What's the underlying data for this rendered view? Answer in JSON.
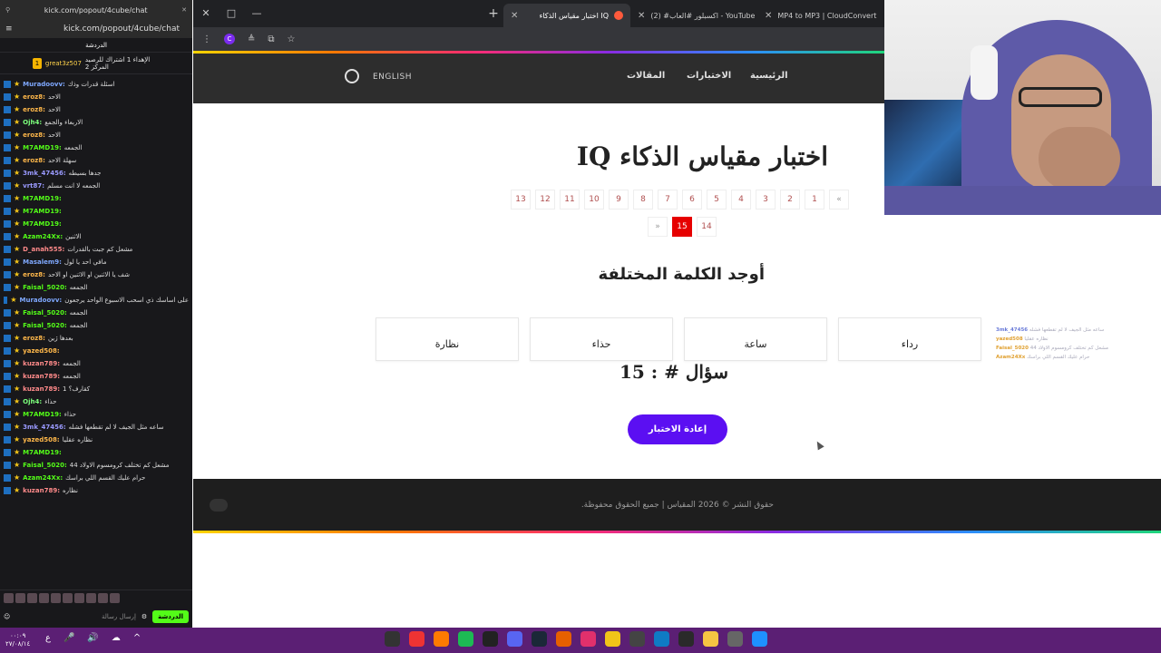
{
  "chat_window": {
    "url": "kick.com/popout/4cube/chat",
    "tab_title": "kick.com/popout/4cube/chat",
    "header": "الدردشة",
    "pinned_user": "great3z507",
    "pinned_text": "الإهداء 1 اشتراك للرصيد المركز 2",
    "send_button": "الدردشة",
    "input_placeholder": "إرسال رسالة",
    "messages": [
      {
        "user": "Muradoovv:",
        "text": "اسئلة قدرات وذك",
        "color": "#7fa8ff"
      },
      {
        "user": "eroz8:",
        "text": "الاحد",
        "color": "#ffb84a"
      },
      {
        "user": "eroz8:",
        "text": "الاحد",
        "color": "#ffb84a"
      },
      {
        "user": "Ojh4:",
        "text": "الاربعاء والجمع",
        "color": "#7cff7c"
      },
      {
        "user": "eroz8:",
        "text": "الاحد",
        "color": "#ffb84a"
      },
      {
        "user": "M7AMD19:",
        "text": "الجمعه",
        "color": "#53fc18"
      },
      {
        "user": "eroz8:",
        "text": "سهلة الاحد",
        "color": "#ffb84a"
      },
      {
        "user": "3mk_47456:",
        "text": "جدها بسيطه",
        "color": "#9a9aff"
      },
      {
        "user": "vrt87:",
        "text": "الجمعه لا انت مسلم",
        "color": "#9a9aff"
      },
      {
        "user": "M7AMD19:",
        "text": "",
        "color": "#53fc18"
      },
      {
        "user": "M7AMD19:",
        "text": "",
        "color": "#53fc18"
      },
      {
        "user": "M7AMD19:",
        "text": "",
        "color": "#53fc18"
      },
      {
        "user": "Azam24Xx:",
        "text": "الاثنين",
        "color": "#53fc18"
      },
      {
        "user": "D_anah555:",
        "text": "مشعل كم جبت بالقدرات",
        "color": "#ff8a8a"
      },
      {
        "user": "Masalem9:",
        "text": "مافي احد يا لول",
        "color": "#7fa8ff"
      },
      {
        "user": "eroz8:",
        "text": "شف يا الاثنين او الاثنين او الاحد",
        "color": "#ffb84a"
      },
      {
        "user": "Faisal_5020:",
        "text": "الجمعه",
        "color": "#53fc18"
      },
      {
        "user": "Muradoovv:",
        "text": "على اساسك ذي اسحب الاسبوع الواحد يرجعون",
        "color": "#7fa8ff"
      },
      {
        "user": "Faisal_5020:",
        "text": "الجمعه",
        "color": "#53fc18"
      },
      {
        "user": "Faisal_5020:",
        "text": "الجمعه",
        "color": "#53fc18"
      },
      {
        "user": "eroz8:",
        "text": "بعدها ژين",
        "color": "#ffb84a"
      },
      {
        "user": "yazed508:",
        "text": "",
        "color": "#ffb84a"
      },
      {
        "user": "kuzan789:",
        "text": "الجمعه",
        "color": "#ff8a8a"
      },
      {
        "user": "kuzan789:",
        "text": "الجمعه",
        "color": "#ff8a8a"
      },
      {
        "user": "kuzan789:",
        "text": "1 كقارف؟",
        "color": "#ff8a8a"
      },
      {
        "user": "Ojh4:",
        "text": "حذاء",
        "color": "#7cff7c"
      },
      {
        "user": "M7AMD19:",
        "text": "حذاء",
        "color": "#53fc18"
      },
      {
        "user": "3mk_47456:",
        "text": "ساعه مثل الجيف لا لم تقطعها فشله",
        "color": "#9a9aff"
      },
      {
        "user": "yazed508:",
        "text": "نظاره عقليا",
        "color": "#ffb84a"
      },
      {
        "user": "M7AMD19:",
        "text": "",
        "color": "#53fc18"
      },
      {
        "user": "Faisal_5020:",
        "text": "مشعل كم تختلف كرومسوم الاولاد 44",
        "color": "#53fc18"
      },
      {
        "user": "Azam24Xx:",
        "text": "حرام عليك القسم اللي براسك",
        "color": "#53fc18"
      },
      {
        "user": "kuzan789:",
        "text": "نظاره",
        "color": "#ff8a8a"
      }
    ]
  },
  "browser": {
    "tabs": [
      {
        "title": "MP4 to MP3 | CloudConvert",
        "fav_color": "#cccccc"
      },
      {
        "title": "(2) #اكسبلور #العاب - YouTube",
        "fav_color": "#ff0000"
      },
      {
        "title": "اختبار مقياس الذكاء IQ",
        "fav_color": "#ff5a3c"
      }
    ],
    "extension_letter": "C"
  },
  "site": {
    "nav": {
      "home": "الرئيسية",
      "tests": "الاختبارات",
      "articles": "المقالات",
      "lang": "ENGLISH"
    },
    "title": "اختبار مقياس الذكاء IQ",
    "pagination_row1": [
      "»",
      "1",
      "2",
      "3",
      "4",
      "5",
      "6",
      "7",
      "8",
      "9",
      "10",
      "11",
      "12",
      "13"
    ],
    "pagination_row2": [
      "14",
      "15",
      "«"
    ],
    "current_page": "15",
    "question": "أوجد الكلمة المختلفة",
    "options": [
      "نظارة",
      "حذاء",
      "ساعة",
      "رداء"
    ],
    "question_number": "سؤال # : 15",
    "retry_button": "إعادة الاختبار",
    "footer": "حقوق النشر © 2026 المقياس | جميع الحقوق محفوظة.",
    "overlay_users": [
      {
        "user": "3mk_47456",
        "text": "ساعه مثل الجيف لا لم تقطعها فشله"
      },
      {
        "user": "yazed508",
        "text": "نظاره عقليا"
      },
      {
        "user": "Faisal_5020",
        "text": "مشعل كم تختلف كرومسوم الاولاد 44"
      },
      {
        "user": "Azam24Xx",
        "text": "حرام عليك القسم اللي براسك"
      }
    ]
  },
  "taskbar": {
    "time": "٠٠:٠٩",
    "date": "٢٧/٠٨/١٤"
  }
}
